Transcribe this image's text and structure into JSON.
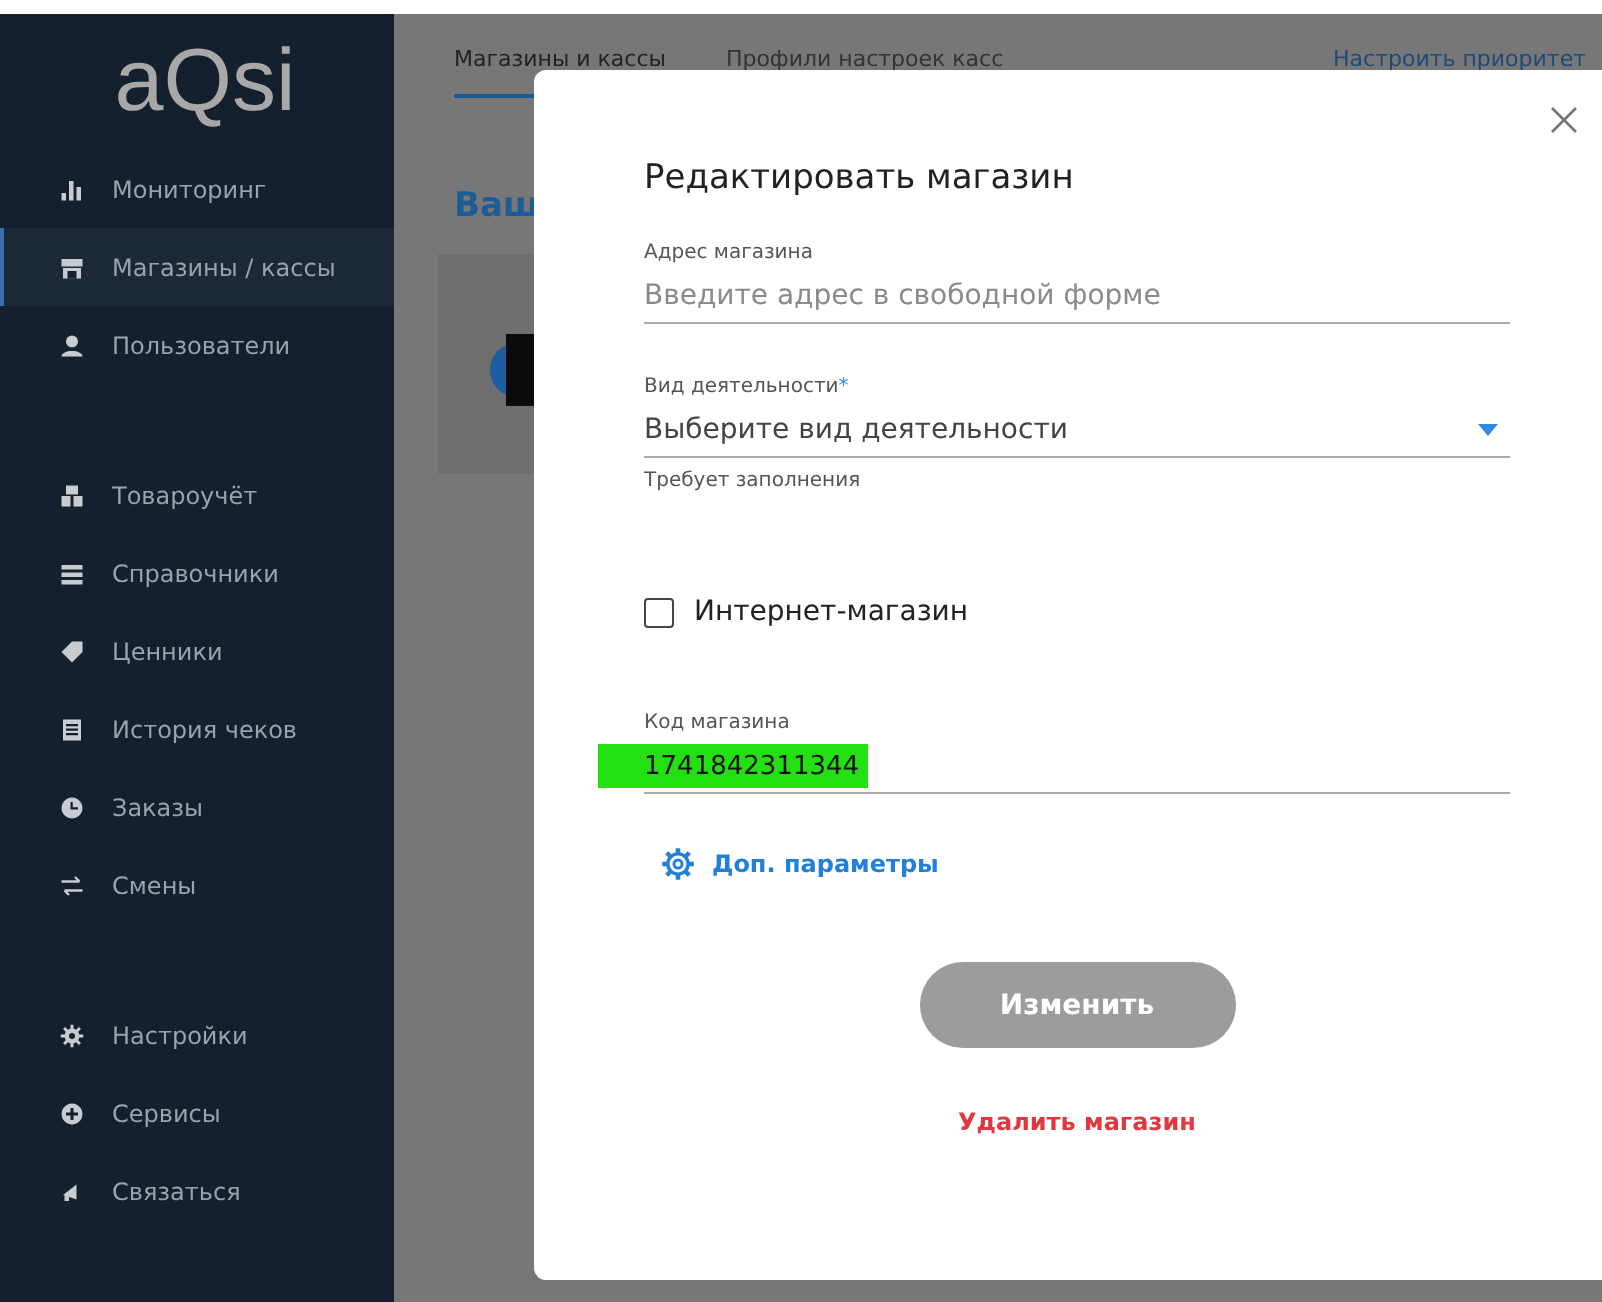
{
  "sidebar": {
    "logo": "aQsi",
    "groups": [
      [
        {
          "label": "Мониторинг",
          "selected": false
        },
        {
          "label": "Магазины / кассы",
          "selected": true
        },
        {
          "label": "Пользователи",
          "selected": false
        }
      ],
      [
        {
          "label": "Товароучёт",
          "selected": false
        },
        {
          "label": "Справочники",
          "selected": false
        },
        {
          "label": "Ценники",
          "selected": false
        },
        {
          "label": "История чеков",
          "selected": false
        },
        {
          "label": "Заказы",
          "selected": false
        },
        {
          "label": "Смены",
          "selected": false
        }
      ],
      [
        {
          "label": "Настройки",
          "selected": false
        },
        {
          "label": "Сервисы",
          "selected": false
        },
        {
          "label": "Связаться",
          "selected": false
        }
      ]
    ]
  },
  "tabs": [
    {
      "label": "Магазины и кассы",
      "selected": true
    },
    {
      "label": "Профили настроек касс",
      "selected": false
    }
  ],
  "header_link": "Настроить приоритет",
  "page_heading": "Ваш",
  "dialog": {
    "title": "Редактировать магазин",
    "fields": [
      {
        "kind": "text",
        "label": "Адрес магазина",
        "placeholder": "Введите адрес в свободной форме"
      },
      {
        "kind": "select",
        "label": "Вид деятельности",
        "required_mark": "*",
        "placeholder": "Выберите вид деятельности",
        "hint": "Требует заполнения"
      },
      {
        "kind": "checkbox",
        "label": "Интернет-магазин",
        "checked": false
      },
      {
        "kind": "text",
        "label": "Код магазина",
        "value": "1741842311344",
        "highlighted": true
      }
    ],
    "extra_link": "Доп. параметры",
    "submit": {
      "label": "Изменить",
      "disabled": true
    },
    "delete_link": "Удалить магазин"
  }
}
